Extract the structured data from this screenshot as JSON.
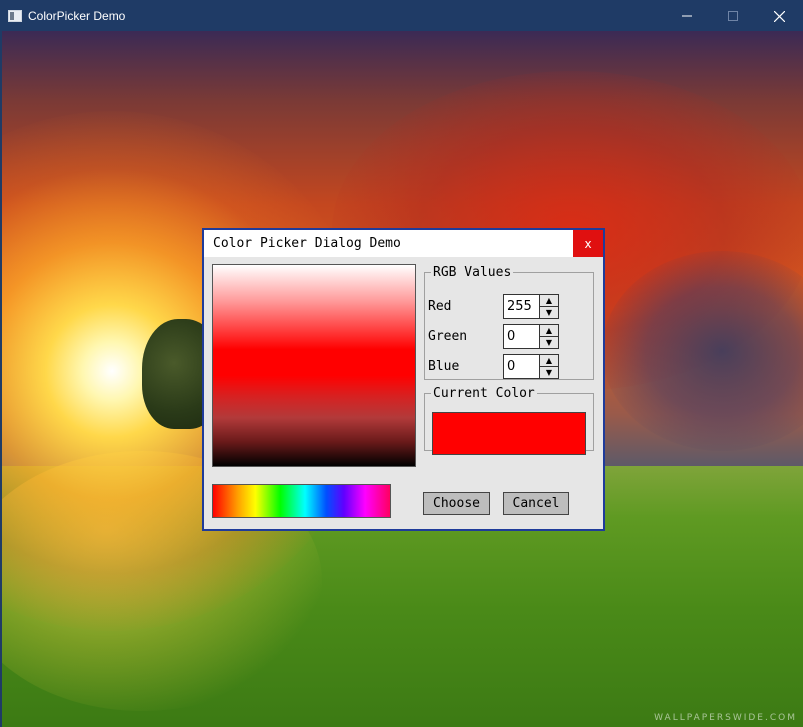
{
  "window": {
    "title": "ColorPicker Demo",
    "minimize_icon": "minimize-icon",
    "maximize_icon": "maximize-icon",
    "close_icon": "close-icon"
  },
  "background": {
    "watermark": "WALLPAPERSWIDE.COM"
  },
  "dialog": {
    "title": "Color Picker Dialog Demo",
    "close_label": "x",
    "rgb_group": {
      "legend": "RGB Values",
      "rows": [
        {
          "label": "Red",
          "value": "255"
        },
        {
          "label": "Green",
          "value": "0"
        },
        {
          "label": "Blue",
          "value": "0"
        }
      ],
      "up_arrow": "▲",
      "down_arrow": "▼"
    },
    "current_color": {
      "legend": "Current Color",
      "swatch_color": "#ff0000"
    },
    "buttons": {
      "choose": "Choose",
      "cancel": "Cancel"
    },
    "shade_base_color": "#ff0000"
  }
}
